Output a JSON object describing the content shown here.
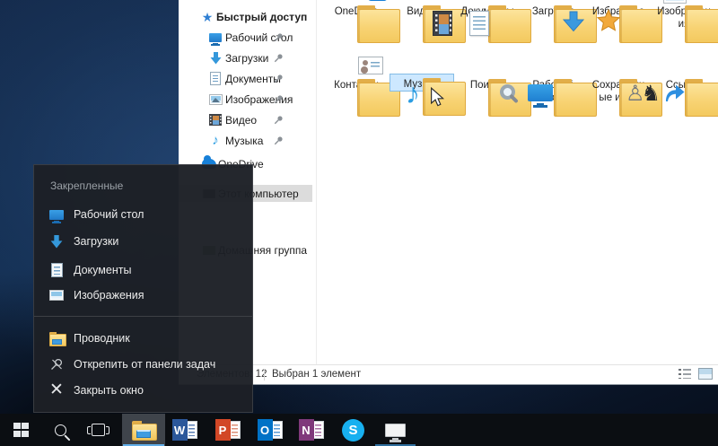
{
  "explorer": {
    "sidebar": {
      "quick_access": "Быстрый доступ",
      "children": [
        {
          "label": "Рабочий стол",
          "icon": "desktop-icon",
          "pinned": true
        },
        {
          "label": "Загрузки",
          "icon": "downloads-icon",
          "pinned": true
        },
        {
          "label": "Документы",
          "icon": "documents-icon",
          "pinned": true
        },
        {
          "label": "Изображения",
          "icon": "pictures-icon",
          "pinned": true
        },
        {
          "label": "Видео",
          "icon": "video-icon",
          "pinned": true
        },
        {
          "label": "Музыка",
          "icon": "music-icon",
          "pinned": true
        }
      ],
      "onedrive": "OneDrive",
      "this_pc": "Этот компьютер",
      "homegroup": "Домашняя группа"
    },
    "folders": [
      {
        "label": "OneDrive",
        "icon": "onedrive-cloud-icon"
      },
      {
        "label": "Видео",
        "icon": "video-film-icon"
      },
      {
        "label": "Документы",
        "icon": "document-page-icon"
      },
      {
        "label": "Загрузки",
        "icon": "download-arrow-icon"
      },
      {
        "label": "Избранное",
        "icon": "favorites-star-icon"
      },
      {
        "label": "Изображения",
        "icon": "pictures-photo-icon"
      },
      {
        "label": "Контакты",
        "icon": "contacts-card-icon"
      },
      {
        "label": "Музыка",
        "icon": "music-note-icon",
        "selected": true
      },
      {
        "label": "Поиски",
        "icon": "search-magnifier-icon"
      },
      {
        "label": "Рабочий стол",
        "icon": "desktop-monitor-icon"
      },
      {
        "label": "Сохраненные игры",
        "icon": "saved-games-chess-icon"
      },
      {
        "label": "Ссылки",
        "icon": "links-arrow-icon"
      }
    ],
    "statusbar": {
      "items_count": "Элементов: 12",
      "selection": "Выбран 1 элемент"
    }
  },
  "jumplist": {
    "header": "Закрепленные",
    "pinned": [
      {
        "label": "Рабочий стол",
        "icon": "desktop-icon"
      },
      {
        "label": "Загрузки",
        "icon": "downloads-icon"
      },
      {
        "label": "Документы",
        "icon": "documents-icon"
      },
      {
        "label": "Изображения",
        "icon": "pictures-icon"
      }
    ],
    "actions": [
      {
        "label": "Проводник",
        "icon": "explorer-folder-icon"
      },
      {
        "label": "Открепить от панели задач",
        "icon": "unpin-icon"
      },
      {
        "label": "Закрыть окно",
        "icon": "close-icon"
      }
    ]
  },
  "taskbar": {
    "apps": {
      "word_letter": "W",
      "powerpoint_letter": "P",
      "outlook_letter": "O",
      "onenote_letter": "N",
      "skype_letter": "S"
    }
  },
  "glyphs": {
    "quick_access_star": "★",
    "music_note": "♪",
    "chess_pawn": "♙",
    "chess_knight": "♞",
    "close_x": "✕"
  },
  "colors": {
    "selection_fill": "#cde8ff",
    "selection_border": "#84bce6",
    "folder_yellow": "#f8d373",
    "accent_blue": "#2b9de2",
    "taskbar_bg": "#0b0e12",
    "jumplist_bg": "#1d2026",
    "active_underline": "#61aee8",
    "running_underline": "#2f6f9e"
  }
}
